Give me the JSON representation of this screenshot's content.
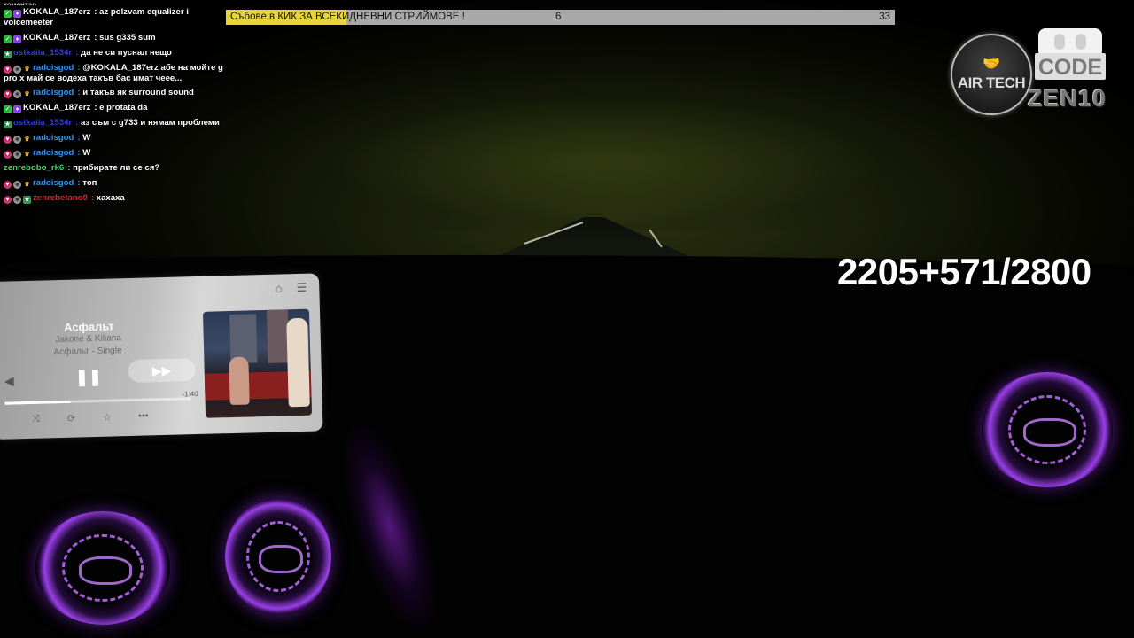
{
  "chat": {
    "top_fragment": "коментар",
    "messages": [
      {
        "badges": [
          "green",
          "purple"
        ],
        "user": "KOKALA_187erz",
        "color": "#ffffff",
        "text": "az polzvam equalizer i voicemeeter"
      },
      {
        "badges": [
          "green",
          "purple"
        ],
        "user": "KOKALA_187erz",
        "color": "#ffffff",
        "text": "sus g335 sum"
      },
      {
        "badges": [
          "sub"
        ],
        "user": "ostkaila_1534r",
        "color": "#2f3fd6",
        "text": "да не си пуснал нещо"
      },
      {
        "badges": [
          "heart",
          "grey",
          "crown"
        ],
        "user": "radoisgod",
        "color": "#3c92e8",
        "text": "@KOKALA_187erz абе на мойте g pro x май се водеха такъв бас имат чеее..."
      },
      {
        "badges": [
          "heart",
          "grey",
          "crown"
        ],
        "user": "radoisgod",
        "color": "#3c92e8",
        "text": "и такъв як surround sound"
      },
      {
        "badges": [
          "green",
          "purple"
        ],
        "user": "KOKALA_187erz",
        "color": "#ffffff",
        "text": "e protata da"
      },
      {
        "badges": [
          "sub"
        ],
        "user": "ostkaila_1534r",
        "color": "#2f3fd6",
        "text": "аз съм с g733 и нямам проблеми"
      },
      {
        "badges": [
          "heart",
          "grey",
          "crown"
        ],
        "user": "radoisgod",
        "color": "#3c92e8",
        "text": "W"
      },
      {
        "badges": [
          "heart",
          "grey",
          "crown"
        ],
        "user": "radoisgod",
        "color": "#3c92e8",
        "text": "W"
      },
      {
        "badges": [],
        "user": "zenrebobo_rk6",
        "color": "#3fd66a",
        "text": "прибирате ли се ся?"
      },
      {
        "badges": [
          "heart",
          "grey",
          "crown"
        ],
        "user": "radoisgod",
        "color": "#3c92e8",
        "text": "топ"
      },
      {
        "badges": [
          "heart",
          "grey",
          "sub"
        ],
        "user": "zenrebetano0",
        "color": "#e0202a",
        "text": "хахаха"
      }
    ]
  },
  "ticker": {
    "text": "Събове в КИК ЗА ВСЕКИДНЕВНИ СТРИЙМОВЕ !",
    "current": "6",
    "goal": "33",
    "progress_fraction": 0.18
  },
  "logos": {
    "air_tech": "AIR TECH",
    "code": "CODE",
    "zen": "ZEN10"
  },
  "counter": "2205+571/2800",
  "player": {
    "title": "Асфальт",
    "artist": "Jakone & Kiliana",
    "album": "Асфальт - Single",
    "time_remaining": "-1:40",
    "progress_fraction": 0.35
  },
  "colors": {
    "ticker_fill": "#e7d33a",
    "ambient_purple": "#a855f7"
  }
}
